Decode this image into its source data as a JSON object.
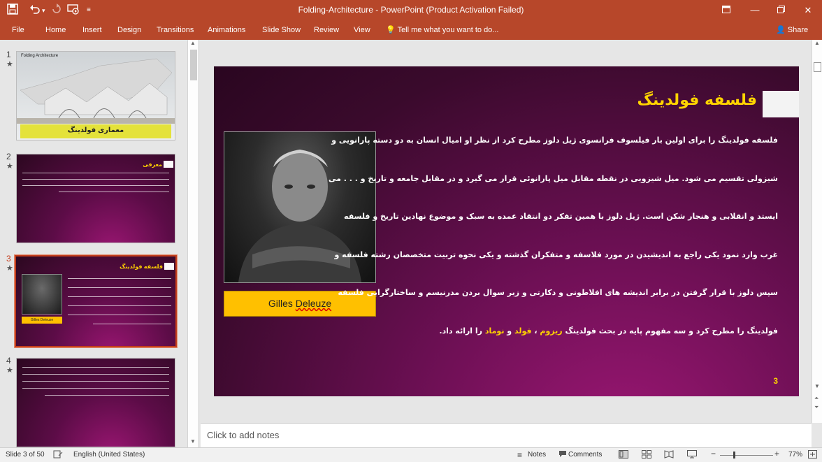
{
  "window": {
    "title": "Folding-Architecture - PowerPoint (Product Activation Failed)"
  },
  "quick_access": {
    "icons": [
      "save-icon",
      "undo-icon",
      "redo-icon",
      "start-from-beginning-icon",
      "customize-icon"
    ]
  },
  "ribbon": {
    "tabs": [
      "File",
      "Home",
      "Insert",
      "Design",
      "Transitions",
      "Animations",
      "Slide Show",
      "Review",
      "View"
    ],
    "tell_me": "Tell me what you want to do...",
    "share": "Share"
  },
  "thumbnails": [
    {
      "number": "1",
      "star": "★",
      "title_small": "Folding Architecture",
      "caption": "معماری فولدینگ"
    },
    {
      "number": "2",
      "star": "★",
      "title": "معرفی"
    },
    {
      "number": "3",
      "star": "★",
      "title": "فلسفه فولدینگ",
      "caption": "Gilles Deleuze"
    },
    {
      "number": "4",
      "star": "★"
    }
  ],
  "slide": {
    "title": "فلسفه فولدینگ",
    "caption_first": "Gilles",
    "caption_second": "Deleuze",
    "lines": [
      "فلسفه فولدینگ را برای اولین بار فیلسوف فرانسوی ژیل دلوز مطرح کرد از نظر او امیال انسان به دو دسته پارانویی و",
      "شیزولی تقسیم می شود. میل شیزویی در نقطه مقابل میل پارانوئی قرار می گیرد و در مقابل جامعه و تاریخ و . . . می",
      "ایستد و انقلابی و هنجار شکن است. ژیل دلوز با همین تفکر دو انتقاد عمده به سبک و موضوع نهادین تاریخ و فلسفه",
      "غرب وارد نمود یکی راجع به اندیشیدن در مورد فلاسفه و متفکران گذشته و یکی نحوه تربیت متخصصان رشته فلسفه و",
      "سپس دلوز با قرار گرفتن در برابر اندیشه های افلاطونی و دکارتی و زیر سوال بردن مدرنیسم و ساختارگرایی فلسفه"
    ],
    "last_line": {
      "part1": "فولدینگ را مطرح کرد و سه مفهوم پایه در بحث فولدینگ ",
      "hl1": "ریزوم",
      "sep1": " ، ",
      "hl2": "فولد",
      "sep2": " و ",
      "hl3": "نوماد",
      "part2": " را ارائه داد."
    },
    "page_number": "3"
  },
  "notes": {
    "placeholder": "Click to add notes"
  },
  "status": {
    "slide_info": "Slide 3 of 50",
    "language": "English (United States)",
    "notes": "Notes",
    "comments": "Comments",
    "zoom": "77%",
    "zoom_minus": "−",
    "zoom_plus": "+"
  },
  "colors": {
    "ribbon": "#b7472a",
    "slide_title": "#ffd400",
    "caption_box": "#ffc000",
    "active_thumb_border": "#c43e1c"
  }
}
